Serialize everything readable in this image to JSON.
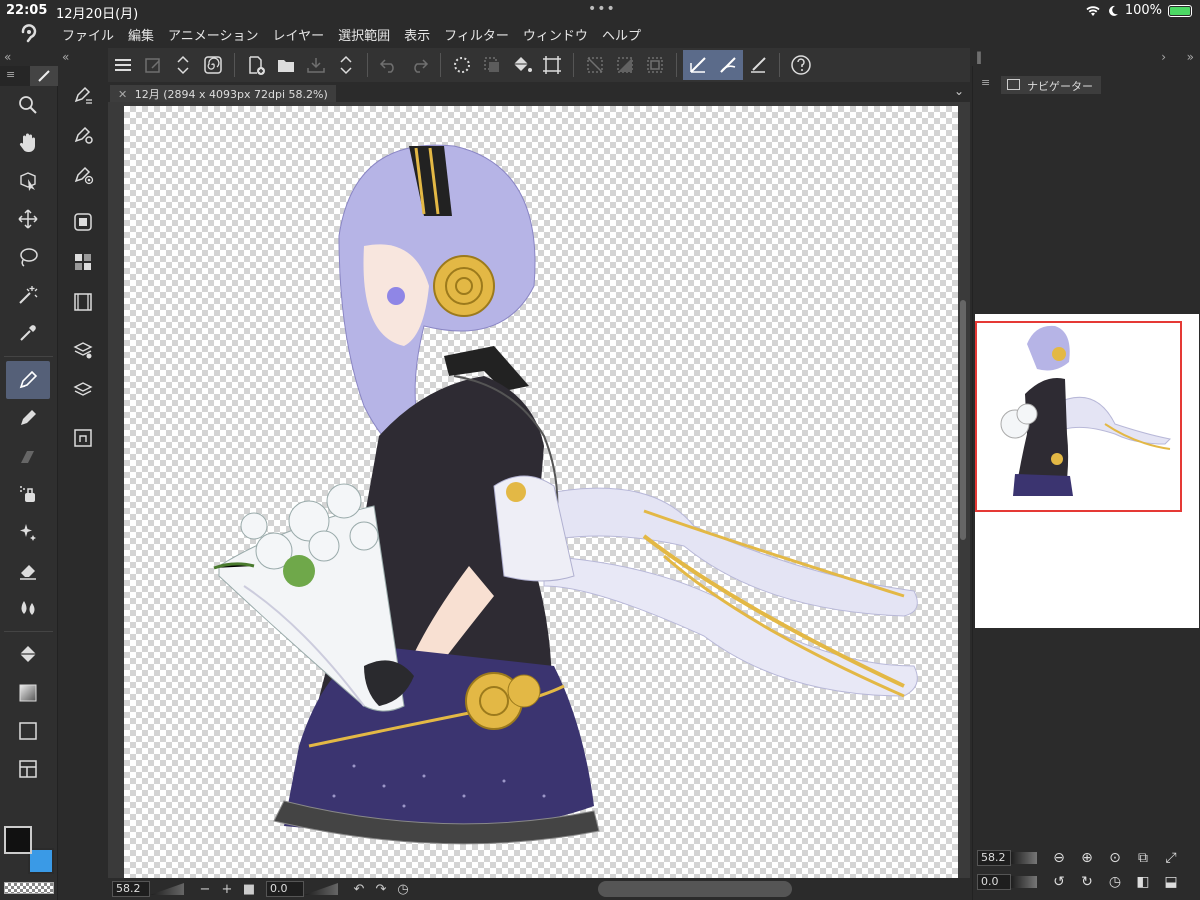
{
  "status": {
    "time": "22:05",
    "date": "12月20日(月)",
    "battery": "100%"
  },
  "menu": [
    "ファイル",
    "編集",
    "アニメーション",
    "レイヤー",
    "選択範囲",
    "表示",
    "フィルター",
    "ウィンドウ",
    "ヘルプ"
  ],
  "document": {
    "tab_label": "12月 (2894 x 4093px 72dpi 58.2%)"
  },
  "bottom": {
    "zoom": "58.2",
    "rotation": "0.0"
  },
  "navigator": {
    "tab_label": "ナビゲーター",
    "zoom": "58.2",
    "rotation": "0.0"
  },
  "colors": {
    "main": "#111111",
    "sub": "#3a9ae6",
    "accent": "#5b6b8a",
    "nav_frame": "#e53935"
  }
}
